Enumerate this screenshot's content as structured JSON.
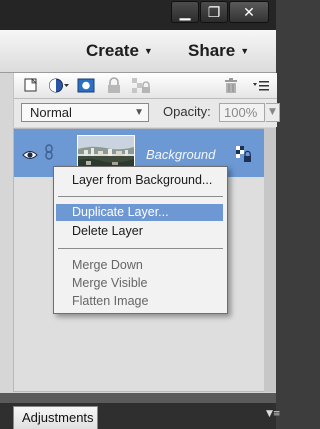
{
  "window": {
    "minimize_glyph": "▁",
    "maximize_glyph": "❐",
    "close_glyph": "✕"
  },
  "header": {
    "create_label": "Create",
    "share_label": "Share",
    "dropdown_glyph": "▼"
  },
  "toolbar": {
    "icons": [
      "new-layer-icon",
      "adjustment-layer-icon",
      "layer-mask-icon",
      "lock-all-icon",
      "lock-transparency-icon",
      "trash-icon",
      "panel-menu-icon"
    ]
  },
  "options": {
    "blend_mode": "Normal",
    "opacity_label": "Opacity:",
    "opacity_value": "100%"
  },
  "layer": {
    "name": "Background",
    "selection_color": "#6c98d3"
  },
  "context_menu": {
    "items": [
      {
        "label": "Layer from Background...",
        "enabled": true
      },
      {
        "label": "Duplicate Layer...",
        "enabled": true,
        "highlighted": true
      },
      {
        "label": "Delete Layer",
        "enabled": true
      },
      {
        "label": "Merge Down",
        "enabled": false
      },
      {
        "label": "Merge Visible",
        "enabled": false
      },
      {
        "label": "Flatten Image",
        "enabled": false
      }
    ]
  },
  "bottom_tabs": {
    "adjustments_label": "Adjustments"
  }
}
